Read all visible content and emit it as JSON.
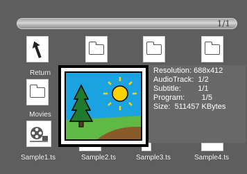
{
  "pagination": {
    "current": "1/1"
  },
  "files": [
    {
      "label": "Return",
      "icon": "return-arrow-icon"
    },
    {
      "label": "Movies",
      "icon": "folder-icon"
    },
    {
      "label": "Sample1.ts",
      "icon": "film-reel-icon"
    },
    {
      "label": "Sample2.ts",
      "icon": "folder-icon"
    },
    {
      "label": "Sample3.ts",
      "icon": "folder-icon"
    },
    {
      "label": "Sample4.ts",
      "icon": "folder-icon"
    }
  ],
  "info": {
    "resolution": "Resolution: 688x412",
    "audio_track": "AudioTrack:  1/2",
    "subtitle": "Subtitle:        1/1",
    "program": "Program:        1/5",
    "size": "Size:  511457 KBytes"
  },
  "colors": {
    "background": "#5e5e5e",
    "preview_sky": "#1aa3e0",
    "preview_grass": "#5fb944",
    "preview_sun": "#ffd200"
  }
}
